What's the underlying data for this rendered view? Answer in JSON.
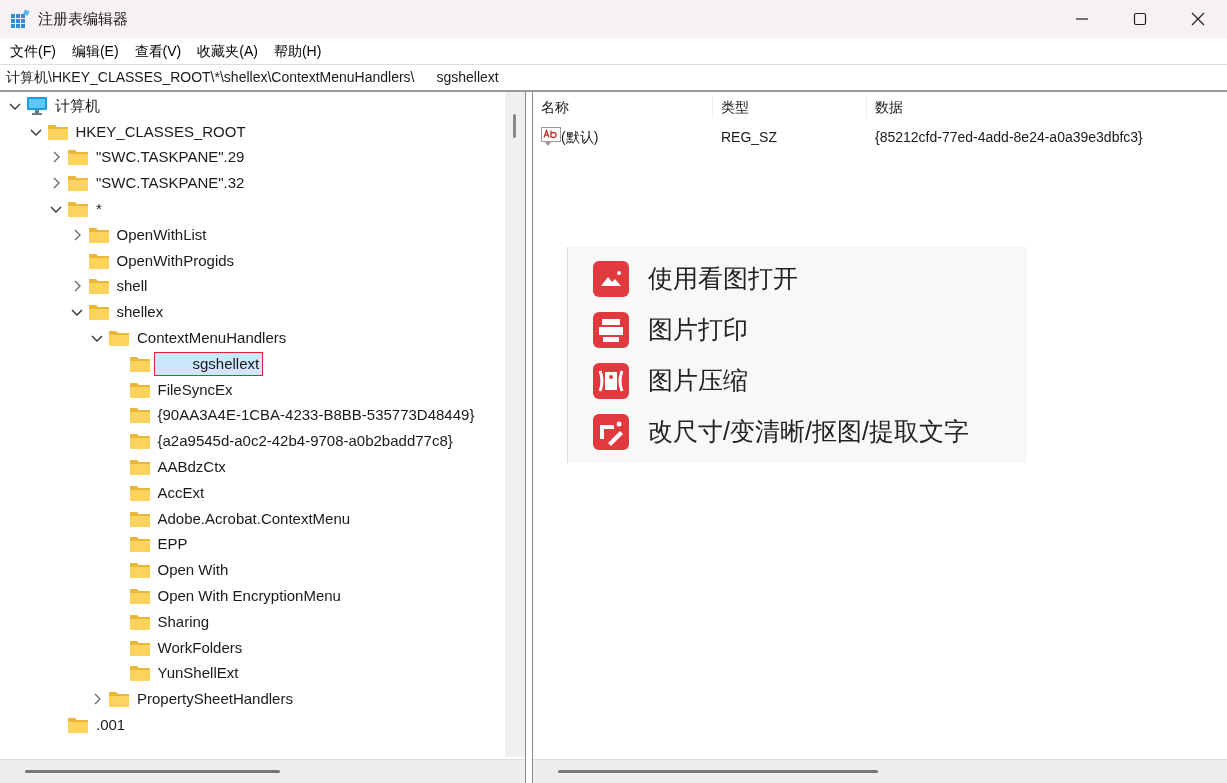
{
  "window": {
    "title": "注册表编辑器"
  },
  "menu": [
    "文件(F)",
    "编辑(E)",
    "查看(V)",
    "收藏夹(A)",
    "帮助(H)"
  ],
  "address": {
    "path": "计算机\\HKEY_CLASSES_ROOT\\*\\shellex\\ContextMenuHandlers\\",
    "key": "sgshellext"
  },
  "tree": [
    {
      "label": "计算机",
      "kind": "computer",
      "expanded": true,
      "selected": false,
      "children": [
        {
          "label": "HKEY_CLASSES_ROOT",
          "kind": "folder",
          "expanded": true,
          "selected": false,
          "children": [
            {
              "label": "\"SWC.TASKPANE\".29",
              "kind": "folder",
              "expanded": false,
              "selected": false
            },
            {
              "label": "\"SWC.TASKPANE\".32",
              "kind": "folder",
              "expanded": false,
              "selected": false
            },
            {
              "label": "*",
              "kind": "folder",
              "expanded": true,
              "selected": false,
              "children": [
                {
                  "label": "OpenWithList",
                  "kind": "folder",
                  "expanded": false,
                  "selected": false
                },
                {
                  "label": "OpenWithProgids",
                  "kind": "folder",
                  "selected": false
                },
                {
                  "label": "shell",
                  "kind": "folder",
                  "expanded": false,
                  "selected": false
                },
                {
                  "label": "shellex",
                  "kind": "folder",
                  "expanded": true,
                  "selected": false,
                  "children": [
                    {
                      "label": "ContextMenuHandlers",
                      "kind": "folder",
                      "expanded": true,
                      "selected": false,
                      "children": [
                        {
                          "label": "sgshellext",
                          "kind": "folder",
                          "selected": true
                        },
                        {
                          "label": "FileSyncEx",
                          "kind": "folder",
                          "selected": false
                        },
                        {
                          "label": "{90AA3A4E-1CBA-4233-B8BB-535773D48449}",
                          "kind": "folder",
                          "selected": false
                        },
                        {
                          "label": "{a2a9545d-a0c2-42b4-9708-a0b2badd77c8}",
                          "kind": "folder",
                          "selected": false
                        },
                        {
                          "label": "AABdzCtx",
                          "kind": "folder",
                          "selected": false
                        },
                        {
                          "label": "AccExt",
                          "kind": "folder",
                          "selected": false
                        },
                        {
                          "label": "Adobe.Acrobat.ContextMenu",
                          "kind": "folder",
                          "selected": false
                        },
                        {
                          "label": "EPP",
                          "kind": "folder",
                          "selected": false
                        },
                        {
                          "label": "Open With",
                          "kind": "folder",
                          "selected": false
                        },
                        {
                          "label": "Open With EncryptionMenu",
                          "kind": "folder",
                          "selected": false
                        },
                        {
                          "label": "Sharing",
                          "kind": "folder",
                          "selected": false
                        },
                        {
                          "label": "WorkFolders",
                          "kind": "folder",
                          "selected": false
                        },
                        {
                          "label": "YunShellExt",
                          "kind": "folder",
                          "selected": false
                        }
                      ]
                    },
                    {
                      "label": "PropertySheetHandlers",
                      "kind": "folder",
                      "expanded": false,
                      "selected": false
                    }
                  ]
                }
              ]
            },
            {
              "label": ".001",
              "kind": "folder",
              "selected": false
            }
          ]
        }
      ]
    }
  ],
  "values": {
    "columns": [
      "名称",
      "类型",
      "数据"
    ],
    "rows": [
      {
        "name": "(默认)",
        "type": "REG_SZ",
        "data": "{85212cfd-77ed-4add-8e24-a0a39e3dbfc3}"
      }
    ]
  },
  "context_menu": [
    {
      "label": "使用看图打开",
      "kind": "picture"
    },
    {
      "label": "图片打印",
      "kind": "print"
    },
    {
      "label": "图片压缩",
      "kind": "compress"
    },
    {
      "label": "改尺寸/变清晰/抠图/提取文字",
      "kind": "edit"
    }
  ]
}
